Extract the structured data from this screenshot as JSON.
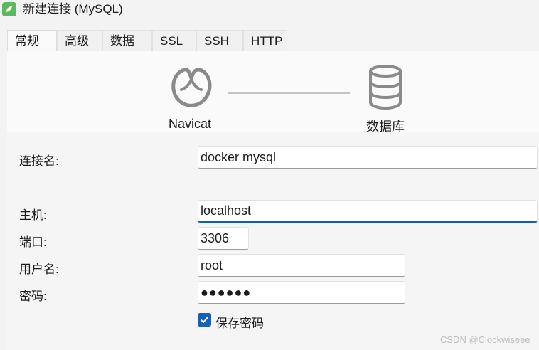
{
  "window": {
    "title": "新建连接 (MySQL)"
  },
  "tabs": [
    "常规",
    "高级",
    "数据库",
    "SSL",
    "SSH",
    "HTTP"
  ],
  "header": {
    "left_label": "Navicat",
    "right_label": "数据库"
  },
  "form": {
    "connection_name_label": "连接名:",
    "connection_name_value": "docker mysql",
    "host_label": "主机:",
    "host_value": "localhost",
    "port_label": "端口:",
    "port_value": "3306",
    "username_label": "用户名:",
    "username_value": "root",
    "password_label": "密码:",
    "password_value": "●●●●●●",
    "save_password_label": "保存密码",
    "save_password_checked": true
  },
  "watermark": "CSDN @Clockwiseee",
  "colors": {
    "accent": "#1a5fb4",
    "app_icon": "#5cb85c"
  }
}
